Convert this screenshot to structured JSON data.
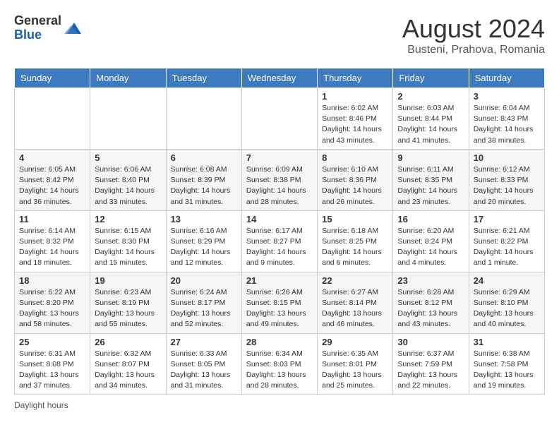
{
  "header": {
    "logo_general": "General",
    "logo_blue": "Blue",
    "main_title": "August 2024",
    "subtitle": "Busteni, Prahova, Romania"
  },
  "days_of_week": [
    "Sunday",
    "Monday",
    "Tuesday",
    "Wednesday",
    "Thursday",
    "Friday",
    "Saturday"
  ],
  "weeks": [
    [
      {
        "day": "",
        "info": ""
      },
      {
        "day": "",
        "info": ""
      },
      {
        "day": "",
        "info": ""
      },
      {
        "day": "",
        "info": ""
      },
      {
        "day": "1",
        "info": "Sunrise: 6:02 AM\nSunset: 8:46 PM\nDaylight: 14 hours\nand 43 minutes."
      },
      {
        "day": "2",
        "info": "Sunrise: 6:03 AM\nSunset: 8:44 PM\nDaylight: 14 hours\nand 41 minutes."
      },
      {
        "day": "3",
        "info": "Sunrise: 6:04 AM\nSunset: 8:43 PM\nDaylight: 14 hours\nand 38 minutes."
      }
    ],
    [
      {
        "day": "4",
        "info": "Sunrise: 6:05 AM\nSunset: 8:42 PM\nDaylight: 14 hours\nand 36 minutes."
      },
      {
        "day": "5",
        "info": "Sunrise: 6:06 AM\nSunset: 8:40 PM\nDaylight: 14 hours\nand 33 minutes."
      },
      {
        "day": "6",
        "info": "Sunrise: 6:08 AM\nSunset: 8:39 PM\nDaylight: 14 hours\nand 31 minutes."
      },
      {
        "day": "7",
        "info": "Sunrise: 6:09 AM\nSunset: 8:38 PM\nDaylight: 14 hours\nand 28 minutes."
      },
      {
        "day": "8",
        "info": "Sunrise: 6:10 AM\nSunset: 8:36 PM\nDaylight: 14 hours\nand 26 minutes."
      },
      {
        "day": "9",
        "info": "Sunrise: 6:11 AM\nSunset: 8:35 PM\nDaylight: 14 hours\nand 23 minutes."
      },
      {
        "day": "10",
        "info": "Sunrise: 6:12 AM\nSunset: 8:33 PM\nDaylight: 14 hours\nand 20 minutes."
      }
    ],
    [
      {
        "day": "11",
        "info": "Sunrise: 6:14 AM\nSunset: 8:32 PM\nDaylight: 14 hours\nand 18 minutes."
      },
      {
        "day": "12",
        "info": "Sunrise: 6:15 AM\nSunset: 8:30 PM\nDaylight: 14 hours\nand 15 minutes."
      },
      {
        "day": "13",
        "info": "Sunrise: 6:16 AM\nSunset: 8:29 PM\nDaylight: 14 hours\nand 12 minutes."
      },
      {
        "day": "14",
        "info": "Sunrise: 6:17 AM\nSunset: 8:27 PM\nDaylight: 14 hours\nand 9 minutes."
      },
      {
        "day": "15",
        "info": "Sunrise: 6:18 AM\nSunset: 8:25 PM\nDaylight: 14 hours\nand 6 minutes."
      },
      {
        "day": "16",
        "info": "Sunrise: 6:20 AM\nSunset: 8:24 PM\nDaylight: 14 hours\nand 4 minutes."
      },
      {
        "day": "17",
        "info": "Sunrise: 6:21 AM\nSunset: 8:22 PM\nDaylight: 14 hours\nand 1 minute."
      }
    ],
    [
      {
        "day": "18",
        "info": "Sunrise: 6:22 AM\nSunset: 8:20 PM\nDaylight: 13 hours\nand 58 minutes."
      },
      {
        "day": "19",
        "info": "Sunrise: 6:23 AM\nSunset: 8:19 PM\nDaylight: 13 hours\nand 55 minutes."
      },
      {
        "day": "20",
        "info": "Sunrise: 6:24 AM\nSunset: 8:17 PM\nDaylight: 13 hours\nand 52 minutes."
      },
      {
        "day": "21",
        "info": "Sunrise: 6:26 AM\nSunset: 8:15 PM\nDaylight: 13 hours\nand 49 minutes."
      },
      {
        "day": "22",
        "info": "Sunrise: 6:27 AM\nSunset: 8:14 PM\nDaylight: 13 hours\nand 46 minutes."
      },
      {
        "day": "23",
        "info": "Sunrise: 6:28 AM\nSunset: 8:12 PM\nDaylight: 13 hours\nand 43 minutes."
      },
      {
        "day": "24",
        "info": "Sunrise: 6:29 AM\nSunset: 8:10 PM\nDaylight: 13 hours\nand 40 minutes."
      }
    ],
    [
      {
        "day": "25",
        "info": "Sunrise: 6:31 AM\nSunset: 8:08 PM\nDaylight: 13 hours\nand 37 minutes."
      },
      {
        "day": "26",
        "info": "Sunrise: 6:32 AM\nSunset: 8:07 PM\nDaylight: 13 hours\nand 34 minutes."
      },
      {
        "day": "27",
        "info": "Sunrise: 6:33 AM\nSunset: 8:05 PM\nDaylight: 13 hours\nand 31 minutes."
      },
      {
        "day": "28",
        "info": "Sunrise: 6:34 AM\nSunset: 8:03 PM\nDaylight: 13 hours\nand 28 minutes."
      },
      {
        "day": "29",
        "info": "Sunrise: 6:35 AM\nSunset: 8:01 PM\nDaylight: 13 hours\nand 25 minutes."
      },
      {
        "day": "30",
        "info": "Sunrise: 6:37 AM\nSunset: 7:59 PM\nDaylight: 13 hours\nand 22 minutes."
      },
      {
        "day": "31",
        "info": "Sunrise: 6:38 AM\nSunset: 7:58 PM\nDaylight: 13 hours\nand 19 minutes."
      }
    ]
  ],
  "footer": {
    "note": "Daylight hours"
  }
}
